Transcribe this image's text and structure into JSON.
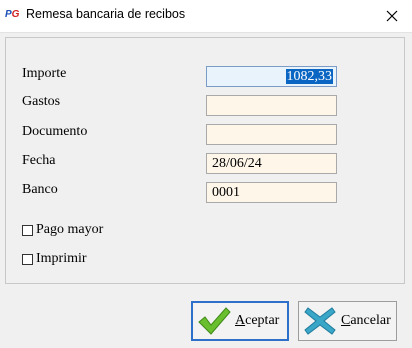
{
  "window": {
    "title": "Remesa bancaria de recibos",
    "app_icon_text_p": "P",
    "app_icon_text_g": "G"
  },
  "form": {
    "importe": {
      "label": "Importe",
      "value": "1082,33"
    },
    "gastos": {
      "label": "Gastos",
      "value": ""
    },
    "documento": {
      "label": "Documento",
      "value": ""
    },
    "fecha": {
      "label": "Fecha",
      "value": "28/06/24"
    },
    "banco": {
      "label": "Banco",
      "value": "0001"
    }
  },
  "options": {
    "pago_mayor": {
      "label": "Pago mayor",
      "checked": false
    },
    "imprimir": {
      "label": "Imprimir",
      "checked": false
    }
  },
  "buttons": {
    "aceptar": {
      "accel": "A",
      "rest": "ceptar"
    },
    "cancelar": {
      "accel": "C",
      "rest": "ancelar"
    }
  },
  "colors": {
    "ok_icon": "#6abf2e",
    "cancel_icon": "#3aa6c8",
    "selection": "#0a66c2"
  }
}
